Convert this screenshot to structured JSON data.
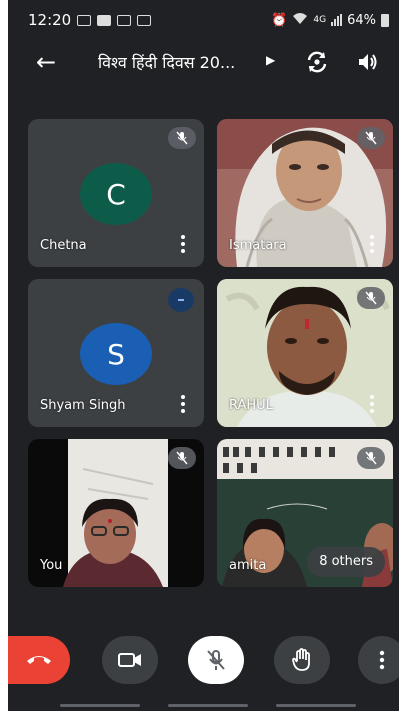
{
  "status": {
    "time": "12:20",
    "battery": "64%",
    "network": "4G"
  },
  "meeting": {
    "title": "विश्व हिंदी दिवस 20...",
    "back_label": "←"
  },
  "tiles": [
    {
      "name": "Chetna",
      "initial": "C",
      "avatar_color": "#0d5c49"
    },
    {
      "name": "Ismatara"
    },
    {
      "name": "Shyam Singh",
      "initial": "S",
      "avatar_color": "#1a5fb4"
    },
    {
      "name": "RAHUL"
    },
    {
      "name": "You"
    },
    {
      "name": "amita",
      "others_label": "8 others"
    }
  ],
  "controls": {
    "end_call": "end-call",
    "camera": "camera",
    "mic": "mic-off",
    "raise_hand": "raise-hand",
    "more": "more-options"
  },
  "colors": {
    "end_call": "#ea4335",
    "tile_bg": "#3c4043",
    "screen_bg": "#202124"
  }
}
